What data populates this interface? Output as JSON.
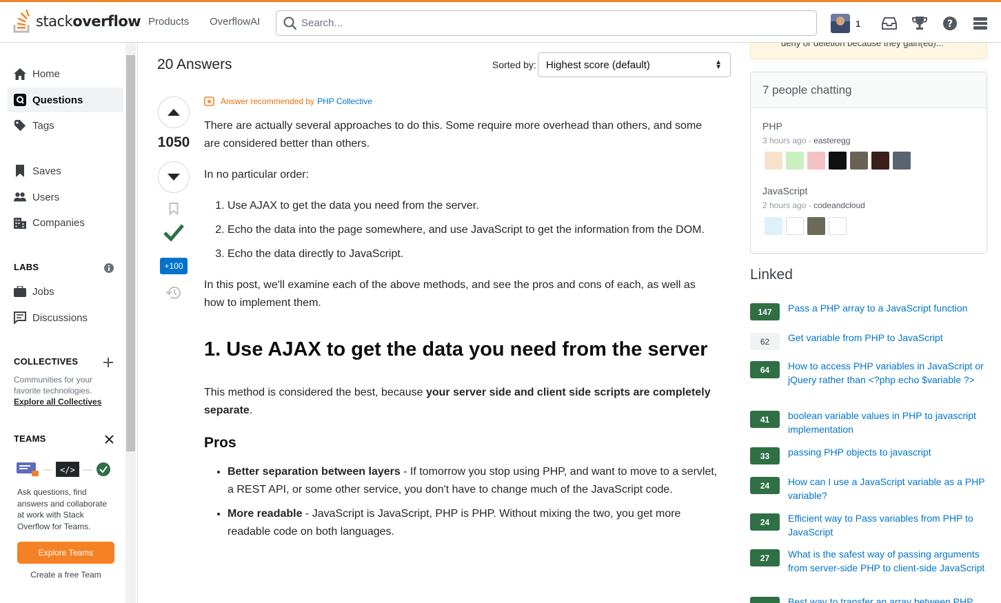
{
  "header": {
    "logo_light": "stack",
    "logo_bold": "overflow",
    "nav": [
      "Products",
      "OverflowAI"
    ],
    "search_placeholder": "Search...",
    "reputation": "1"
  },
  "sidebar": {
    "items": [
      {
        "label": "Home",
        "icon": "home-icon"
      },
      {
        "label": "Questions",
        "icon": "questions-icon"
      },
      {
        "label": "Tags",
        "icon": "tag-icon"
      },
      {
        "label": "Saves",
        "icon": "bookmark-icon"
      },
      {
        "label": "Users",
        "icon": "users-icon"
      },
      {
        "label": "Companies",
        "icon": "companies-icon"
      }
    ],
    "labs": {
      "heading": "LABS",
      "items": [
        {
          "label": "Jobs",
          "icon": "briefcase-icon"
        },
        {
          "label": "Discussions",
          "icon": "discussions-icon"
        }
      ]
    },
    "collectives": {
      "heading": "COLLECTIVES",
      "description": "Communities for your favorite technologies.",
      "link": "Explore all Collectives"
    },
    "teams": {
      "heading": "TEAMS",
      "description": "Ask questions, find answers and collaborate at work with Stack Overflow for Teams.",
      "button": "Explore Teams",
      "link": "Create a free Team"
    }
  },
  "answers": {
    "count_label": "20 Answers",
    "sorted_by_label": "Sorted by:",
    "sort_value": "Highest score (default)"
  },
  "answer": {
    "score": "1050",
    "bounty": "+100",
    "recommended_prefix": "Answer recommended by",
    "collective": "PHP Collective",
    "p1": "There are actually several approaches to do this. Some require more overhead than others, and some are considered better than others.",
    "p2": "In no particular order:",
    "list": [
      "Use AJAX to get the data you need from the server.",
      "Echo the data into the page somewhere, and use JavaScript to get the information from the DOM.",
      "Echo the data directly to JavaScript."
    ],
    "p3": "In this post, we'll examine each of the above methods, and see the pros and cons of each, as well as how to implement them.",
    "h1": "1. Use AJAX to get the data you need from the server",
    "p4_pre": "This method is considered the best, because ",
    "p4_bold": "your server side and client side scripts are completely separate",
    "p4_post": ".",
    "h2": "Pros",
    "pros": [
      {
        "bold": "Better separation between layers",
        "text": " - If tomorrow you stop using PHP, and want to move to a servlet, a REST API, or some other service, you don't have to change much of the JavaScript code."
      },
      {
        "bold": "More readable",
        "text": " - JavaScript is JavaScript, PHP is PHP. Without mixing the two, you get more readable code on both languages."
      }
    ]
  },
  "notice": {
    "text": "deny or deletion because they gain(ed)..."
  },
  "chat": {
    "heading": "7 people chatting",
    "rooms": [
      {
        "name": "PHP",
        "time": "3 hours ago",
        "user": "easteregg",
        "avatar_colors": [
          "#f7e1cc",
          "#c9f0c0",
          "#f3c1c1",
          "#101010",
          "#6b6256",
          "#3a1f1a",
          "#5a6470"
        ]
      },
      {
        "name": "JavaScript",
        "time": "2 hours ago",
        "user": "codeandcloud",
        "avatar_colors": [
          "#dff0fb",
          "#ffffff",
          "#6b6a58",
          "#ffffff"
        ]
      }
    ]
  },
  "linked": {
    "heading": "Linked",
    "items": [
      {
        "score": "147",
        "title": "Pass a PHP array to a JavaScript function",
        "accepted": true
      },
      {
        "score": "62",
        "title": "Get variable from PHP to JavaScript",
        "accepted": false
      },
      {
        "score": "64",
        "title": "How to access PHP variables in JavaScript or jQuery rather than <?php echo $variable ?>",
        "accepted": true
      },
      {
        "score": "41",
        "title": "boolean variable values in PHP to javascript implementation",
        "accepted": true
      },
      {
        "score": "33",
        "title": "passing PHP objects to javascript",
        "accepted": true
      },
      {
        "score": "24",
        "title": "How can I use a JavaScript variable as a PHP variable?",
        "accepted": true
      },
      {
        "score": "24",
        "title": "Efficient way to Pass variables from PHP to JavaScript",
        "accepted": true
      },
      {
        "score": "27",
        "title": "What is the safest way of passing arguments from server-side PHP to client-side JavaScript",
        "accepted": true
      },
      {
        "score": "",
        "title": "Best way to transfer an array between PHP",
        "accepted": true
      }
    ]
  },
  "colors": {
    "brand_orange": "#f48225",
    "link_blue": "#0074cc",
    "accepted_green": "#2f6f44"
  }
}
